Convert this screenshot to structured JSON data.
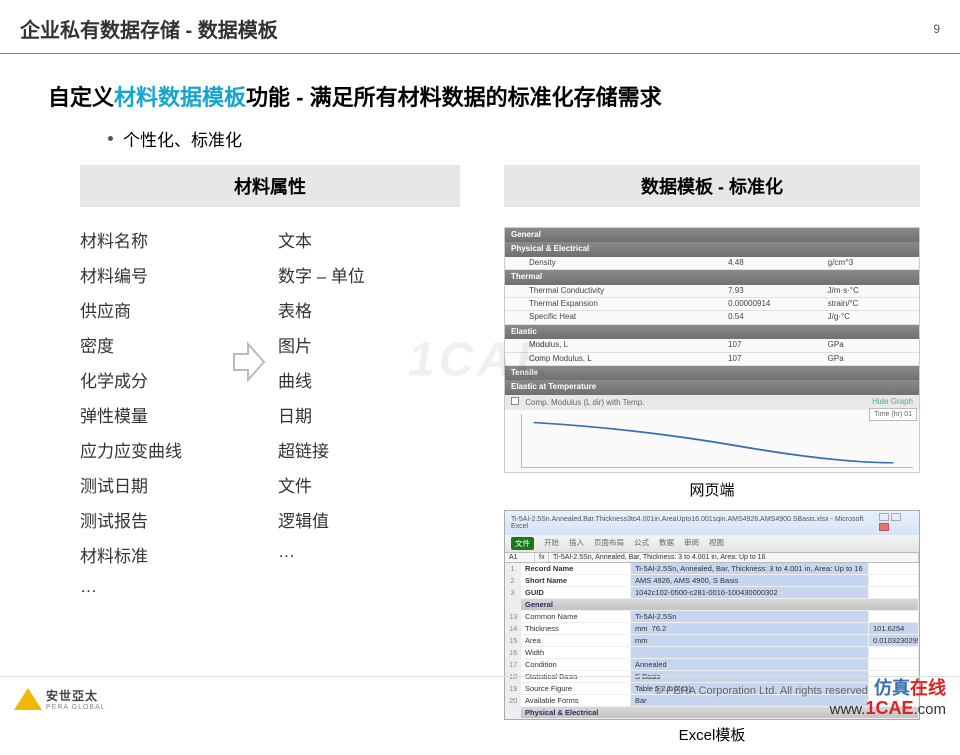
{
  "page": {
    "title": "企业私有数据存储 - 数据模板",
    "number": "9",
    "watermark": "1CAE"
  },
  "headline": {
    "pre": "自定义",
    "hl": "材料数据模板",
    "post": "功能 - 满足所有材料数据的标准化存储需求"
  },
  "bullet": "个性化、标准化",
  "left": {
    "header": "材料属性",
    "rows": [
      {
        "name": "材料名称",
        "type": "文本"
      },
      {
        "name": "材料编号",
        "type": "数字 – 单位"
      },
      {
        "name": "供应商",
        "type": "表格"
      },
      {
        "name": "密度",
        "type": "图片"
      },
      {
        "name": "化学成分",
        "type": "曲线"
      },
      {
        "name": "弹性模量",
        "type": "日期"
      },
      {
        "name": "应力应变曲线",
        "type": "超链接"
      },
      {
        "name": "测试日期",
        "type": "文件"
      },
      {
        "name": "测试报告",
        "type": "逻辑值"
      },
      {
        "name": "材料标准",
        "type": "…"
      },
      {
        "name": "…",
        "type": ""
      }
    ]
  },
  "right": {
    "header": "数据模板 - 标准化",
    "web_caption": "网页端",
    "excel_caption": "Excel模板",
    "web": {
      "sections": {
        "general": "General",
        "physical": "Physical & Electrical",
        "thermal": "Thermal",
        "elastic": "Elastic",
        "tensile": "Tensile",
        "elastic_temp": "Elastic at Temperature"
      },
      "rows": {
        "density": {
          "label": "Density",
          "value": "4.48",
          "unit": "g/cm^3"
        },
        "tc": {
          "label": "Thermal Conductivity",
          "value": "7.93",
          "unit": "J/m·s·°C"
        },
        "te": {
          "label": "Thermal Expansion",
          "value": "0.00000914",
          "unit": "strain/°C"
        },
        "sh": {
          "label": "Specific Heat",
          "value": "0.54",
          "unit": "J/g·°C"
        },
        "ml": {
          "label": "Modulus, L",
          "value": "107",
          "unit": "GPa"
        },
        "cml": {
          "label": "Comp Modulus, L",
          "value": "107",
          "unit": "GPa"
        }
      },
      "graph_title": "Comp. Modulus (L dir) with Temp.",
      "hide_graph": "Hide Graph",
      "legend": "Time (hr)\n01"
    },
    "excel": {
      "window_title": "Ti-5Al-2.5Sn.Annealed.Bar.Thickness3to4.001in.AreaUpto16.001sqin.AMS4926.AMS4900.SBasis.xlsx - Microsoft Excel",
      "ribbon": [
        "文件",
        "开始",
        "插入",
        "页面布局",
        "公式",
        "数据",
        "审阅",
        "视图"
      ],
      "name_box": "A1",
      "formula": "Ti-5Al-2.5Sn, Annealed, Bar, Thickness: 3 to 4.001 in, Area: Up to 16",
      "fields": {
        "record_name": {
          "label": "Record Name",
          "value": "Ti-5Al-2.5Sn, Annealed, Bar, Thickness: 3 to 4.001 in, Area: Up to 16"
        },
        "short_name": {
          "label": "Short Name",
          "value": "AMS 4926, AMS 4900, S Basis"
        },
        "guid": {
          "label": "GUID",
          "value": "1042c102-0500-c281-0016-100430000302"
        },
        "general": "General",
        "common_name": {
          "label": "Common Name",
          "value": "Ti-5Al-2.5Sn"
        },
        "thickness": {
          "label": "Thickness",
          "v1": "mm",
          "v2": "76.2",
          "v3": "101.6254"
        },
        "area": {
          "label": "Area",
          "v1": "mm",
          "v2": "",
          "v3": "0.0103230295"
        },
        "width": {
          "label": "Width",
          "value": ""
        },
        "condition": {
          "label": "Condition",
          "value": "Annealed"
        },
        "stat_basis": {
          "label": "Statistical Basis",
          "value": "S Basis"
        },
        "src_figure": {
          "label": "Source Figure",
          "value": "Table 5.2.1.0(c1)"
        },
        "avail_forms": {
          "label": "Available Forms",
          "value": "Bar"
        },
        "pe_section": "Physical & Electrical"
      }
    }
  },
  "footer": {
    "logo_main": "安世亞太",
    "logo_sub": "PERA GLOBAL",
    "copyright": "©   PERA Corporation Ltd. All rights reserved",
    "site_cn_a": "仿真",
    "site_cn_b": "在线",
    "site_url_a": "www.",
    "site_url_b": "1CAE",
    "site_url_c": ".com"
  }
}
